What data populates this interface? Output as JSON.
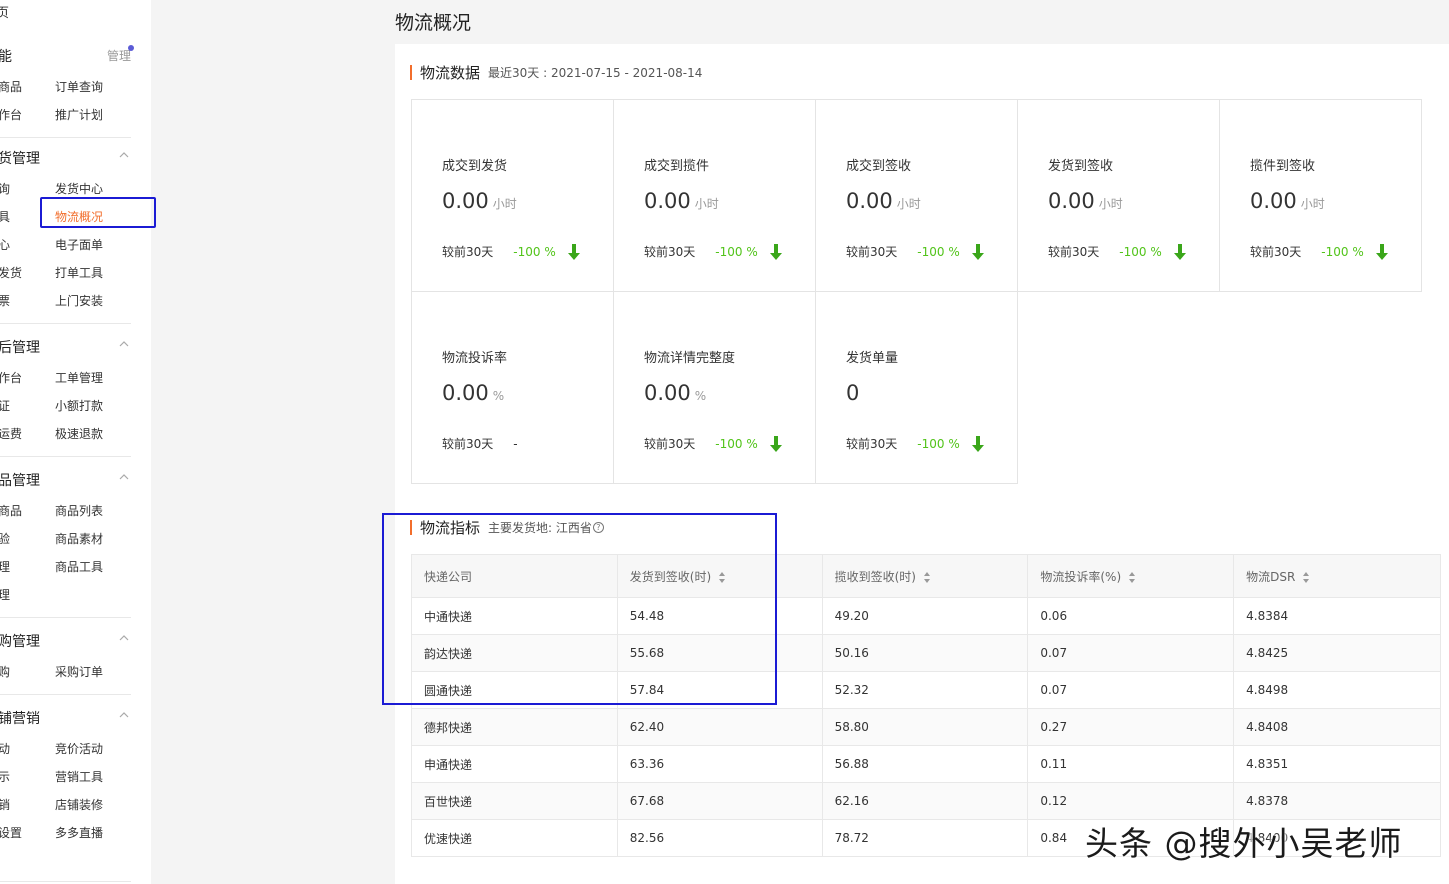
{
  "sidebar": {
    "home": "页",
    "sections": [
      {
        "title": "能",
        "manage": "管理",
        "items": [
          [
            "商品",
            "订单查询"
          ],
          [
            "作台",
            "推广计划"
          ]
        ]
      },
      {
        "title": "货管理",
        "items": [
          [
            "询",
            "发货中心"
          ],
          [
            "具",
            "物流概况"
          ],
          [
            "心",
            "电子面单"
          ],
          [
            "发货",
            "打单工具"
          ],
          [
            "票",
            "上门安装"
          ]
        ]
      },
      {
        "title": "后管理",
        "items": [
          [
            "作台",
            "工单管理"
          ],
          [
            "证",
            "小额打款"
          ],
          [
            "运费",
            "极速退款"
          ]
        ]
      },
      {
        "title": "品管理",
        "items": [
          [
            "商品",
            "商品列表"
          ],
          [
            "验",
            "商品素材"
          ],
          [
            "理",
            "商品工具"
          ],
          [
            "理",
            ""
          ]
        ]
      },
      {
        "title": "购管理",
        "items": [
          [
            "购",
            "采购订单"
          ]
        ]
      },
      {
        "title": "铺营销",
        "items": [
          [
            "动",
            "竞价活动"
          ],
          [
            "示",
            "营销工具"
          ],
          [
            "销",
            "店铺装修"
          ],
          [
            "设置",
            "多多直播"
          ]
        ]
      }
    ]
  },
  "page_title": "物流概况",
  "logistics_data": {
    "title": "物流数据",
    "range": "最近30天 : 2021-07-15 - 2021-08-14",
    "compare_label": "较前30天",
    "metrics": [
      {
        "label": "成交到发货",
        "value": "0.00",
        "unit": "小时",
        "change": "-100 %",
        "arrow": true
      },
      {
        "label": "成交到揽件",
        "value": "0.00",
        "unit": "小时",
        "change": "-100 %",
        "arrow": true
      },
      {
        "label": "成交到签收",
        "value": "0.00",
        "unit": "小时",
        "change": "-100 %",
        "arrow": true
      },
      {
        "label": "发货到签收",
        "value": "0.00",
        "unit": "小时",
        "change": "-100 %",
        "arrow": true
      },
      {
        "label": "揽件到签收",
        "value": "0.00",
        "unit": "小时",
        "change": "-100 %",
        "arrow": true
      },
      {
        "label": "物流投诉率",
        "value": "0.00",
        "unit": "%",
        "change": "-",
        "arrow": false
      },
      {
        "label": "物流详情完整度",
        "value": "0.00",
        "unit": "%",
        "change": "-100 %",
        "arrow": true
      },
      {
        "label": "发货单量",
        "value": "0",
        "unit": "",
        "change": "-100 %",
        "arrow": true
      }
    ]
  },
  "logistics_index": {
    "title": "物流指标",
    "subtitle": "主要发货地: 江西省",
    "help": "?",
    "columns": [
      "快递公司",
      "发货到签收(时)",
      "揽收到签收(时)",
      "物流投诉率(%)",
      "物流DSR"
    ],
    "rows": [
      [
        "中通快递",
        "54.48",
        "49.20",
        "0.06",
        "4.8384"
      ],
      [
        "韵达快递",
        "55.68",
        "50.16",
        "0.07",
        "4.8425"
      ],
      [
        "圆通快递",
        "57.84",
        "52.32",
        "0.07",
        "4.8498"
      ],
      [
        "德邦快递",
        "62.40",
        "58.80",
        "0.27",
        "4.8408"
      ],
      [
        "申通快递",
        "63.36",
        "56.88",
        "0.11",
        "4.8351"
      ],
      [
        "百世快递",
        "67.68",
        "62.16",
        "0.12",
        "4.8378"
      ],
      [
        "优速快递",
        "82.56",
        "78.72",
        "0.84",
        "4.8400"
      ]
    ]
  },
  "watermark": "头条 @搜外小吴老师",
  "colors": {
    "accent": "#f26e2c",
    "positive": "#52c41a",
    "highlight": "#1b1bd4"
  }
}
